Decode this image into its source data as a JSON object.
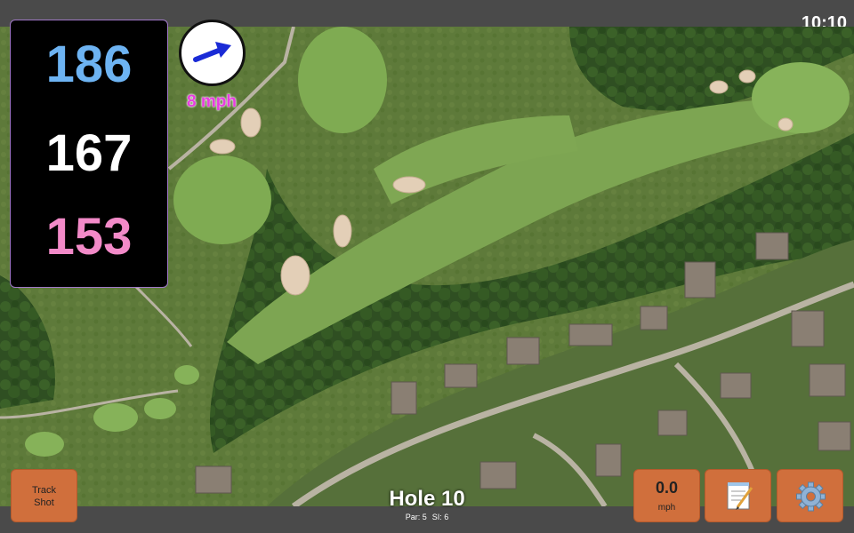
{
  "status_bar": {
    "clock": "10:10"
  },
  "distances": {
    "front": "186",
    "middle": "167",
    "back": "153",
    "colors": {
      "front": "#6db3f2",
      "middle": "#ffffff",
      "back": "#f28ac8"
    }
  },
  "wind": {
    "speed": "8 mph",
    "direction_icon": "arrow-icon"
  },
  "buttons": {
    "track_shot": "Track Shot",
    "speed_value": "0.0",
    "speed_unit": "mph",
    "notes_icon": "notepad-icon",
    "settings_icon": "gear-icon"
  },
  "hole": {
    "title": "Hole 10",
    "par_label": "Par: 5",
    "si_label": "SI: 6"
  },
  "colors": {
    "button_orange": "#d06f3c",
    "bar_gray": "#4a4a4a",
    "wind_text": "#e83de0",
    "arrow_blue": "#1a2bd6"
  }
}
